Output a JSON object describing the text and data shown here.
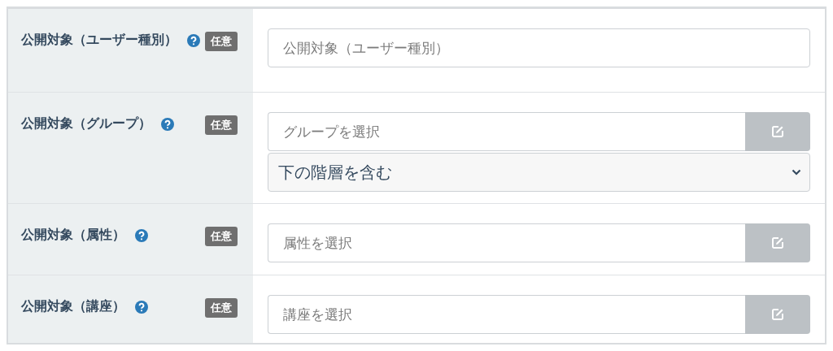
{
  "rows": [
    {
      "label": "公開対象（ユーザー種別）",
      "badge": "任意",
      "fields": [
        {
          "kind": "text",
          "placeholder": "公開対象（ユーザー種別）"
        }
      ]
    },
    {
      "label": "公開対象（グループ）",
      "badge": "任意",
      "fields": [
        {
          "kind": "picker",
          "placeholder": "グループを選択"
        },
        {
          "kind": "select",
          "value": "下の階層を含む"
        }
      ]
    },
    {
      "label": "公開対象（属性）",
      "badge": "任意",
      "fields": [
        {
          "kind": "picker",
          "placeholder": "属性を選択"
        }
      ]
    },
    {
      "label": "公開対象（講座）",
      "badge": "任意",
      "fields": [
        {
          "kind": "picker",
          "placeholder": "講座を選択"
        }
      ]
    }
  ]
}
